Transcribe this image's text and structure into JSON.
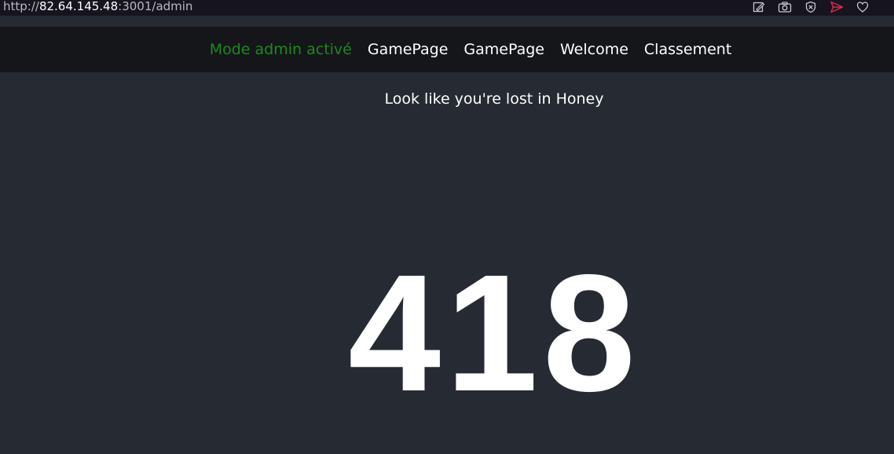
{
  "browser": {
    "url_scheme": "http://",
    "url_host": "82.64.145.48",
    "url_path": ":3001/admin",
    "icons": [
      "edit-page-icon",
      "camera-icon",
      "shield-x-icon",
      "send-icon",
      "heart-icon"
    ],
    "send_icon_color": "#e0294a"
  },
  "nav": {
    "admin_label": "Mode admin activé",
    "admin_color": "#1c8a1c",
    "links": [
      "GamePage",
      "GamePage",
      "Welcome",
      "Classement"
    ]
  },
  "main": {
    "subtitle": "Look like you're lost in Honey",
    "code": "418"
  }
}
